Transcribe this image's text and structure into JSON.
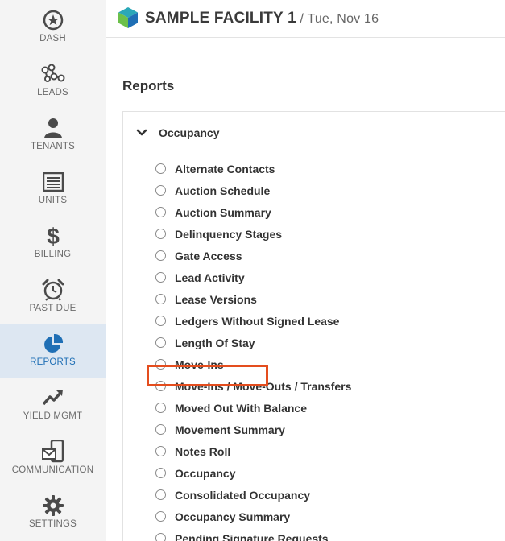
{
  "sidebar": {
    "items": [
      {
        "label": "DASH",
        "icon": "dashboard-icon",
        "active": false
      },
      {
        "label": "LEADS",
        "icon": "leads-icon",
        "active": false
      },
      {
        "label": "TENANTS",
        "icon": "person-icon",
        "active": false
      },
      {
        "label": "UNITS",
        "icon": "units-icon",
        "active": false
      },
      {
        "label": "BILLING",
        "icon": "dollar-icon",
        "active": false
      },
      {
        "label": "PAST DUE",
        "icon": "alarm-clock-icon",
        "active": false
      },
      {
        "label": "REPORTS",
        "icon": "pie-chart-icon",
        "active": true
      },
      {
        "label": "YIELD MGMT",
        "icon": "trend-up-icon",
        "active": false
      },
      {
        "label": "COMMUNICATION",
        "icon": "phone-mail-icon",
        "active": false
      },
      {
        "label": "SETTINGS",
        "icon": "gear-icon",
        "active": false
      }
    ]
  },
  "header": {
    "facility_name": "SAMPLE FACILITY 1",
    "separator_date": " / Tue, Nov 16"
  },
  "main": {
    "title": "Reports",
    "group": {
      "label": "Occupancy",
      "expanded": true,
      "reports": [
        "Alternate Contacts",
        "Auction Schedule",
        "Auction Summary",
        "Delinquency Stages",
        "Gate Access",
        "Lead Activity",
        "Lease Versions",
        "Ledgers Without Signed Lease",
        "Length Of Stay",
        "Move-Ins",
        "Move-Ins / Move-Outs / Transfers",
        "Moved Out With Balance",
        "Movement Summary",
        "Notes Roll",
        "Occupancy",
        "Consolidated Occupancy",
        "Occupancy Summary",
        "Pending Signature Requests"
      ]
    },
    "highlighted_report": "Length Of Stay"
  },
  "colors": {
    "active_nav_bg": "#dde7f2",
    "active_nav_text": "#1f6fb5",
    "highlight_border": "#e44d1e",
    "logo_teal": "#2aa8b8",
    "logo_green": "#6cc04a",
    "logo_blue": "#1f6fb5"
  }
}
